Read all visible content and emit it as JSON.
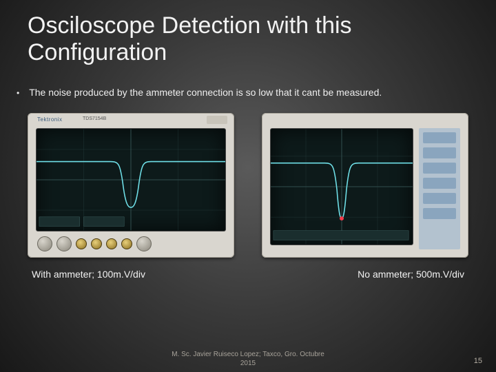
{
  "title": "Osciloscope Detection with this Configuration",
  "bullet": "The noise produced by the ammeter connection is so low that it cant be measured.",
  "scopes": {
    "left_brand": "Tektronix",
    "left_model": "TDS7154B"
  },
  "captions": {
    "left": "With ammeter; 100m.V/div",
    "right": "No ammeter; 500m.V/div"
  },
  "footer_line1": "M. Sc. Javier Ruiseco Lopez; Taxco, Gro. Octubre",
  "footer_line2": "2015",
  "page_number": "15"
}
